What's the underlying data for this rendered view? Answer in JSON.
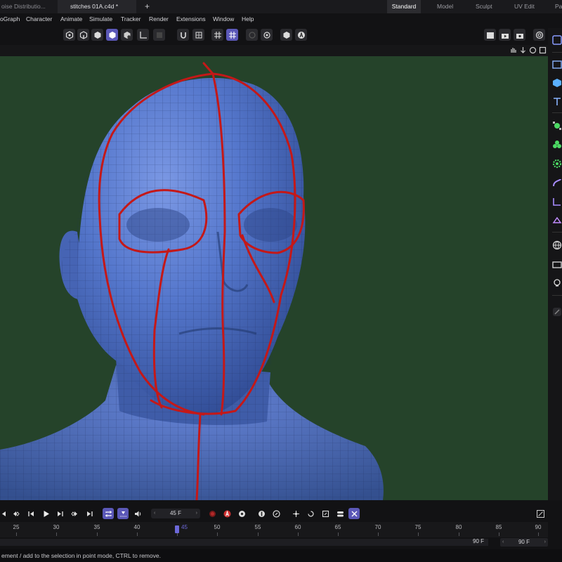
{
  "tabs": [
    {
      "label": "oise Distributio..."
    },
    {
      "label": "stitches 01A.c4d *"
    }
  ],
  "add_tab": "+",
  "layouts": [
    "Standard",
    "Model",
    "Sculpt",
    "UV Edit",
    "Pa"
  ],
  "menu": [
    "oGraph",
    "Character",
    "Animate",
    "Simulate",
    "Tracker",
    "Render",
    "Extensions",
    "Window",
    "Help"
  ],
  "transport": {
    "current_frame": "45 F",
    "prev_arrow": "‹",
    "next_arrow": "›"
  },
  "ruler": {
    "labels": [
      "25",
      "30",
      "35",
      "40",
      "45",
      "50",
      "55",
      "60",
      "65",
      "70",
      "75",
      "80",
      "85",
      "90"
    ],
    "playhead": "45"
  },
  "range": {
    "end": "90 F",
    "field": "90 F",
    "left_arrow": "‹",
    "right_arrow": "›"
  },
  "status": "ement / add to the selection in point mode, CTRL to remove.",
  "colors": {
    "accent": "#5b58b8",
    "viewport_bg": "#25432a",
    "mesh": "#4f6fc4",
    "seam": "#c41818"
  }
}
